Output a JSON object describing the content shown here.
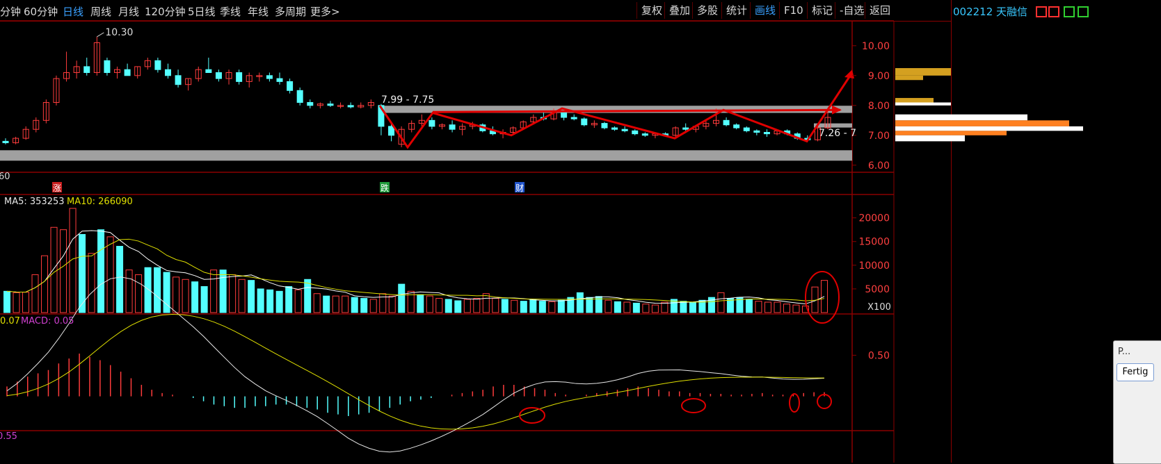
{
  "topbar": {
    "periods": [
      "分钟",
      "60分钟",
      "日线",
      "周线",
      "月线",
      "120分钟",
      "5日线",
      "季线",
      "年线",
      "多周期",
      "更多>"
    ],
    "active_period": "日线",
    "tools": [
      "复权",
      "叠加",
      "多股",
      "统计",
      "画线",
      "F10",
      "标记",
      "-自选",
      "返回"
    ],
    "active_tool": "画线"
  },
  "stock": {
    "label": "002212 天融信"
  },
  "price_panel": {
    "high_label": "10.30",
    "left_edge_label": "60",
    "zone_label_1": "7.99 - 7.75",
    "zone_label_2": "7.26 - 7",
    "event_marks": [
      "涨",
      "跌",
      "财"
    ]
  },
  "volume_panel": {
    "ma5_label": "MA5: 353253",
    "ma10_label": "MA10: 266090",
    "unit_label": "X100"
  },
  "macd_panel": {
    "left_value": "0.07",
    "macd_label": "MACD: 0.05",
    "bottom_label": "0.55"
  },
  "palette": {
    "title": "P...",
    "button": "Fertig"
  },
  "colors": {
    "up": "#ff3c3c",
    "down": "#54ffff",
    "annotation": "#e00000",
    "zone": "#a0a0a0",
    "grid": "#8b0000"
  },
  "chart_data": [
    {
      "type": "candlestick",
      "title": "",
      "y_ticks": [
        10.0,
        9.0,
        8.0,
        7.0,
        6.0
      ],
      "ylim": [
        5.6,
        10.6
      ],
      "candles_ohlc": [
        [
          6.8,
          6.9,
          6.7,
          6.75
        ],
        [
          6.75,
          6.95,
          6.7,
          6.9
        ],
        [
          6.9,
          7.3,
          6.85,
          7.2
        ],
        [
          7.2,
          7.6,
          7.1,
          7.5
        ],
        [
          7.5,
          8.2,
          7.4,
          8.1
        ],
        [
          8.1,
          9.0,
          8.0,
          8.9
        ],
        [
          8.9,
          9.8,
          8.8,
          9.1
        ],
        [
          9.1,
          9.5,
          8.9,
          9.3
        ],
        [
          9.3,
          9.6,
          9.0,
          9.1
        ],
        [
          9.1,
          10.3,
          9.0,
          10.1
        ],
        [
          9.5,
          9.6,
          9.0,
          9.1
        ],
        [
          9.1,
          9.3,
          8.9,
          9.2
        ],
        [
          9.2,
          9.4,
          9.0,
          9.0
        ],
        [
          9.0,
          9.3,
          8.9,
          9.3
        ],
        [
          9.3,
          9.6,
          9.2,
          9.5
        ],
        [
          9.5,
          9.6,
          9.1,
          9.2
        ],
        [
          9.2,
          9.4,
          8.9,
          9.0
        ],
        [
          9.0,
          9.2,
          8.6,
          8.7
        ],
        [
          8.7,
          8.9,
          8.5,
          8.9
        ],
        [
          8.9,
          9.3,
          8.8,
          9.2
        ],
        [
          9.2,
          9.6,
          9.1,
          9.1
        ],
        [
          9.1,
          9.2,
          8.8,
          8.9
        ],
        [
          8.9,
          9.2,
          8.7,
          9.1
        ],
        [
          9.1,
          9.2,
          8.7,
          8.8
        ],
        [
          8.8,
          9.1,
          8.6,
          9.0
        ],
        [
          9.0,
          9.1,
          8.8,
          9.0
        ],
        [
          9.0,
          9.1,
          8.8,
          8.9
        ],
        [
          8.9,
          9.1,
          8.7,
          8.8
        ],
        [
          8.8,
          8.9,
          8.4,
          8.5
        ],
        [
          8.5,
          8.6,
          8.0,
          8.1
        ],
        [
          8.1,
          8.2,
          7.9,
          8.0
        ],
        [
          8.0,
          8.1,
          7.9,
          8.05
        ],
        [
          8.05,
          8.15,
          7.95,
          8.0
        ],
        [
          8.0,
          8.1,
          7.9,
          8.0
        ],
        [
          8.0,
          8.1,
          7.9,
          7.95
        ],
        [
          7.95,
          8.1,
          7.9,
          8.0
        ],
        [
          8.0,
          8.2,
          7.9,
          8.1
        ],
        [
          8.0,
          8.05,
          7.0,
          7.3
        ],
        [
          7.3,
          7.4,
          6.8,
          7.0
        ],
        [
          6.7,
          7.3,
          6.6,
          7.2
        ],
        [
          7.2,
          7.5,
          7.1,
          7.4
        ],
        [
          7.4,
          7.7,
          7.3,
          7.5
        ],
        [
          7.5,
          7.6,
          7.2,
          7.3
        ],
        [
          7.3,
          7.4,
          7.2,
          7.35
        ],
        [
          7.35,
          7.5,
          7.1,
          7.2
        ],
        [
          7.2,
          7.4,
          7.0,
          7.3
        ],
        [
          7.3,
          7.45,
          7.2,
          7.35
        ],
        [
          7.35,
          7.4,
          7.1,
          7.15
        ],
        [
          7.15,
          7.3,
          7.0,
          7.05
        ],
        [
          7.05,
          7.2,
          6.9,
          7.1
        ],
        [
          7.1,
          7.3,
          7.0,
          7.25
        ],
        [
          7.25,
          7.5,
          7.2,
          7.45
        ],
        [
          7.45,
          7.7,
          7.4,
          7.6
        ],
        [
          7.6,
          7.8,
          7.5,
          7.55
        ],
        [
          7.55,
          7.9,
          7.5,
          7.8
        ],
        [
          7.8,
          7.9,
          7.5,
          7.6
        ],
        [
          7.6,
          7.7,
          7.5,
          7.55
        ],
        [
          7.55,
          7.6,
          7.3,
          7.35
        ],
        [
          7.35,
          7.5,
          7.25,
          7.4
        ],
        [
          7.4,
          7.45,
          7.2,
          7.25
        ],
        [
          7.25,
          7.3,
          7.15,
          7.2
        ],
        [
          7.2,
          7.3,
          7.1,
          7.15
        ],
        [
          7.15,
          7.2,
          7.0,
          7.05
        ],
        [
          7.05,
          7.1,
          6.95,
          7.0
        ],
        [
          7.0,
          7.1,
          6.9,
          7.05
        ],
        [
          7.05,
          7.1,
          6.95,
          7.0
        ],
        [
          7.0,
          7.3,
          6.95,
          7.25
        ],
        [
          7.25,
          7.4,
          7.15,
          7.2
        ],
        [
          7.2,
          7.35,
          7.1,
          7.3
        ],
        [
          7.3,
          7.5,
          7.2,
          7.4
        ],
        [
          7.4,
          7.9,
          7.3,
          7.5
        ],
        [
          7.5,
          7.6,
          7.3,
          7.35
        ],
        [
          7.35,
          7.4,
          7.2,
          7.25
        ],
        [
          7.25,
          7.3,
          7.1,
          7.15
        ],
        [
          7.15,
          7.2,
          7.0,
          7.1
        ],
        [
          7.1,
          7.2,
          6.95,
          7.05
        ],
        [
          7.05,
          7.2,
          7.0,
          7.15
        ],
        [
          7.15,
          7.2,
          7.0,
          7.05
        ],
        [
          7.05,
          7.1,
          6.85,
          6.9
        ],
        [
          6.9,
          7.0,
          6.8,
          6.85
        ],
        [
          6.85,
          7.3,
          6.8,
          7.25
        ],
        [
          7.25,
          7.8,
          7.2,
          7.6
        ]
      ]
    },
    {
      "type": "bar",
      "title": "",
      "y_ticks": [
        20000,
        15000,
        10000,
        5000
      ],
      "ylim": [
        0,
        22000
      ],
      "values": [
        4500,
        4200,
        4300,
        8000,
        12000,
        18000,
        17500,
        22000,
        16500,
        12500,
        17500,
        16000,
        14000,
        9000,
        8000,
        9500,
        9500,
        8500,
        7500,
        7000,
        6500,
        5500,
        9000,
        9000,
        8000,
        7000,
        6800,
        5000,
        4800,
        4500,
        5500,
        4800,
        7000,
        4000,
        3500,
        3500,
        3500,
        3200,
        3000,
        2800,
        4000,
        3500,
        6000,
        4500,
        3800,
        3500,
        3000,
        2800,
        2500,
        2800,
        3000,
        4000,
        3000,
        2800,
        2600,
        2400,
        2700,
        2400,
        2300,
        2600,
        3200,
        4200,
        3200,
        3400,
        2600,
        2300,
        2200,
        2000,
        1800,
        1600,
        2200,
        2800,
        2400,
        2200,
        2600,
        3200,
        4200,
        3000,
        3200,
        2800,
        2400,
        2200,
        2200,
        1800,
        1600,
        1400,
        5400,
        6800
      ],
      "ma5_label": "MA5: 353253",
      "ma10_label": "MA10: 266090"
    },
    {
      "type": "bar",
      "title": "",
      "y_ticks": [
        0.5
      ],
      "ylim": [
        -0.35,
        0.85
      ],
      "values": [
        0.12,
        0.18,
        0.24,
        0.28,
        0.32,
        0.4,
        0.46,
        0.52,
        0.48,
        0.44,
        0.38,
        0.3,
        0.22,
        0.14,
        0.08,
        0.04,
        0.02,
        0.0,
        -0.02,
        -0.06,
        -0.1,
        -0.12,
        -0.14,
        -0.14,
        -0.12,
        -0.12,
        -0.1,
        -0.1,
        -0.12,
        -0.14,
        -0.16,
        -0.2,
        -0.22,
        -0.24,
        -0.22,
        -0.2,
        -0.18,
        -0.14,
        -0.1,
        -0.06,
        -0.04,
        -0.02,
        0.0,
        0.02,
        0.04,
        0.06,
        0.08,
        0.12,
        0.14,
        0.14,
        0.12,
        0.1,
        0.08,
        0.04,
        0.02,
        0.0,
        0.02,
        0.04,
        0.06,
        0.08,
        0.1,
        0.12,
        0.1,
        0.08,
        0.06,
        0.06,
        0.04,
        0.04,
        0.03,
        0.03,
        0.02,
        0.02,
        0.03,
        0.04,
        0.02,
        0.02,
        0.03,
        0.04,
        0.05,
        0.05
      ]
    }
  ]
}
